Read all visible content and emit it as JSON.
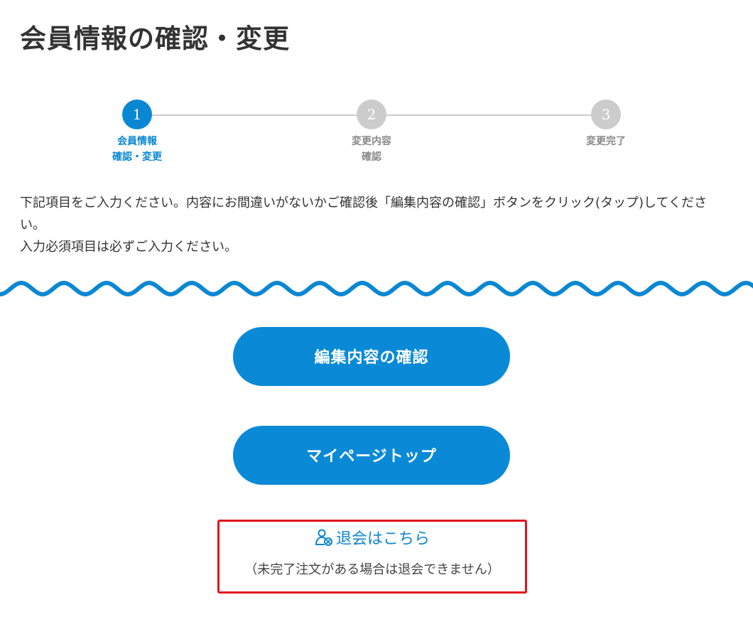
{
  "page": {
    "title": "会員情報の確認・変更"
  },
  "stepper": {
    "steps": [
      {
        "number": "1",
        "label": "会員情報\n確認・変更",
        "state": "active"
      },
      {
        "number": "2",
        "label": "変更内容\n確認",
        "state": "inactive"
      },
      {
        "number": "3",
        "label": "変更完了",
        "state": "inactive"
      }
    ]
  },
  "instructions": {
    "line1": "下記項目をご入力ください。内容にお間違いがないかご確認後「編集内容の確認」ボタンをクリック(タップ)してください。",
    "line2": "入力必須項目は必ずご入力ください。"
  },
  "buttons": {
    "confirm_label": "編集内容の確認",
    "mypage_label": "マイページトップ"
  },
  "withdraw": {
    "icon": "user-remove-icon",
    "link_label": "退会はこちら",
    "note": "（未完了注文がある場合は退会できません）"
  },
  "colors": {
    "accent": "#0a87d2",
    "button": "#0a8ad6",
    "inactive_step": "#cccccc",
    "highlight_border": "#e0141e"
  }
}
